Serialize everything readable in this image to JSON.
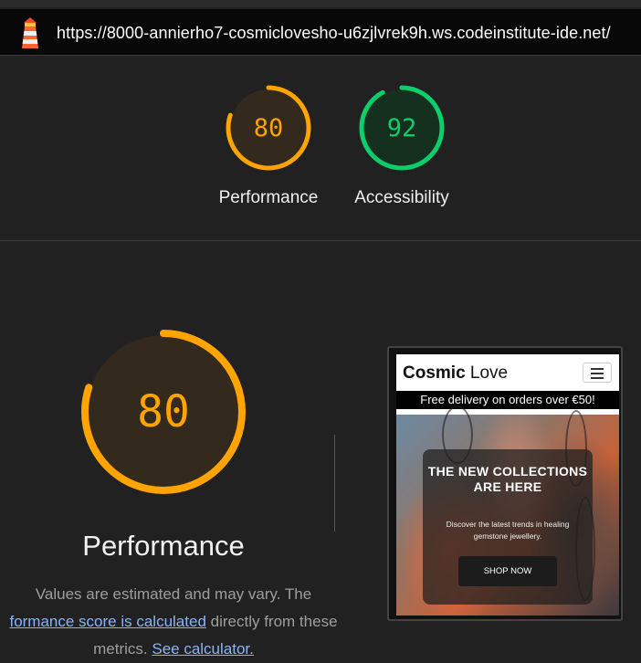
{
  "address_bar": {
    "url": "https://8000-annierho7-cosmiclovesho-u6zjlvrek9h.ws.codeinstitute-ide.net/"
  },
  "summary_scores": [
    {
      "label": "Performance",
      "score": "80",
      "value": 80,
      "color": "#ffa400"
    },
    {
      "label": "Accessibility",
      "score": "92",
      "value": 92,
      "color": "#0cce6b"
    }
  ],
  "performance": {
    "score": "80",
    "value": 80,
    "label": "Performance",
    "note_before": "Values are estimated and may vary. The",
    "note_link": "formance score is calculated",
    "note_mid": "directly from these metrics.",
    "calculator_link": "See calculator."
  },
  "screenshot_preview": {
    "brand_bold": "Cosmic",
    "brand_light": "Love",
    "banner": "Free delivery on orders over €50!",
    "hero_title": "THE NEW COLLECTIONS ARE HERE",
    "hero_sub": "Discover the latest trends in healing gemstone jewellery.",
    "cta": "SHOP NOW"
  },
  "colors": {
    "average": "#ffa400",
    "pass": "#0cce6b",
    "background": "#212121"
  }
}
